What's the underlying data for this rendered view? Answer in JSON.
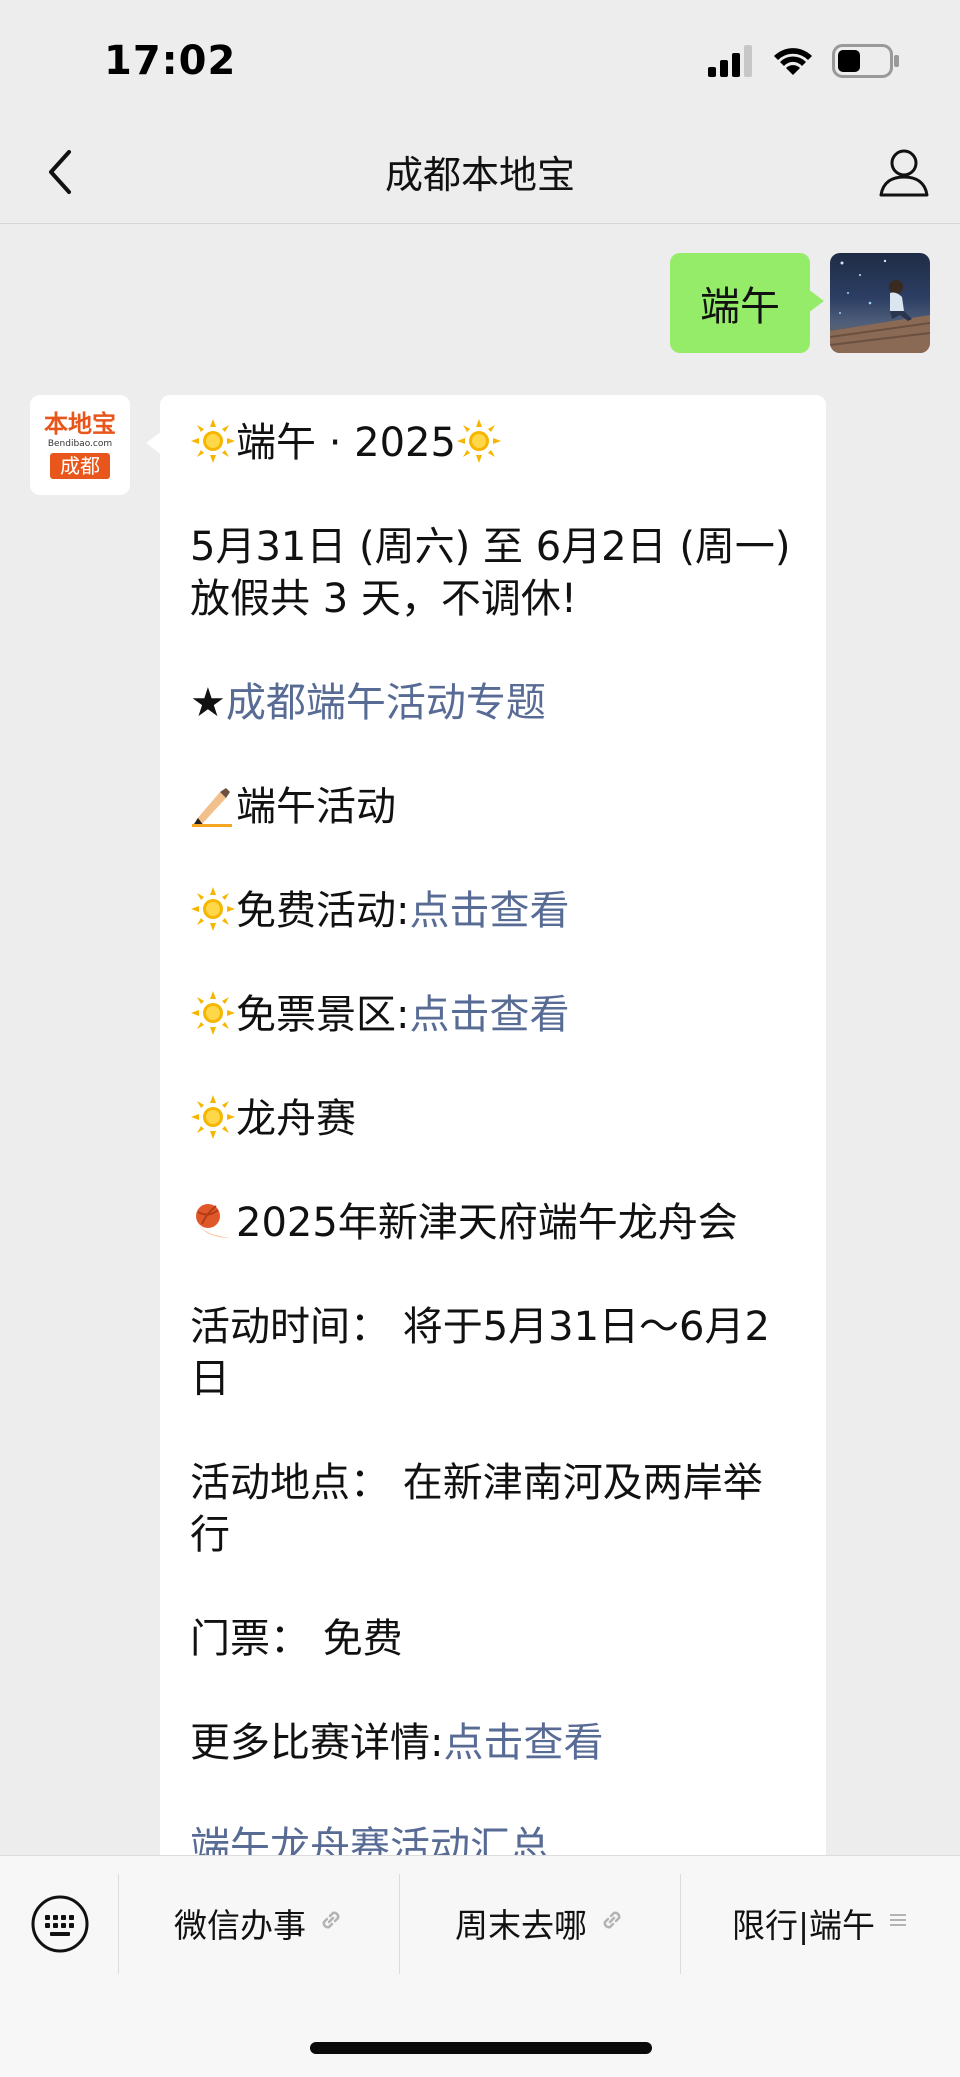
{
  "status_bar": {
    "time": "17:02",
    "battery_level": 0.45
  },
  "header": {
    "title": "成都本地宝",
    "back_icon": "chevron-left-icon",
    "profile_icon": "user-icon"
  },
  "outgoing": {
    "text": "端午"
  },
  "bot": {
    "avatar": {
      "brand": "本地宝",
      "site": "Bendibao.com",
      "city": "成都"
    },
    "message": {
      "title": "端午 · 2025",
      "dates_line1": "5月31日 (周六) 至 6月2日 (周一)",
      "dates_line2": "放假共 3 天，不调休!",
      "star": "★",
      "topic_link": "成都端午活动专题",
      "activities_heading": "端午活动",
      "free_activity_label": "免费活动:",
      "free_activity_link": "点击查看",
      "free_scenic_label": "免票景区:",
      "free_scenic_link": "点击查看",
      "dragon_boat": "龙舟赛",
      "event_name": "2025年新津天府端午龙舟会",
      "time_line1": "活动时间： 将于5月31日～6月2",
      "time_line2": "日",
      "place_line1": "活动地点： 在新津南河及两岸举",
      "place_line2": "行",
      "ticket": "门票： 免费",
      "more_label": "更多比赛详情:",
      "more_link": "点击查看",
      "summary_link": "端午龙舟赛活动汇总"
    }
  },
  "menu": {
    "keyboard_icon": "keyboard-icon",
    "items": [
      {
        "label": "微信办事",
        "icon": "link-icon"
      },
      {
        "label": "周末去哪",
        "icon": "link-icon"
      },
      {
        "label": "限行|端午",
        "icon": "menu-list-icon"
      }
    ]
  },
  "colors": {
    "link": "#576b95",
    "bubble_out": "#95ec69",
    "brand": "#e8561b"
  }
}
